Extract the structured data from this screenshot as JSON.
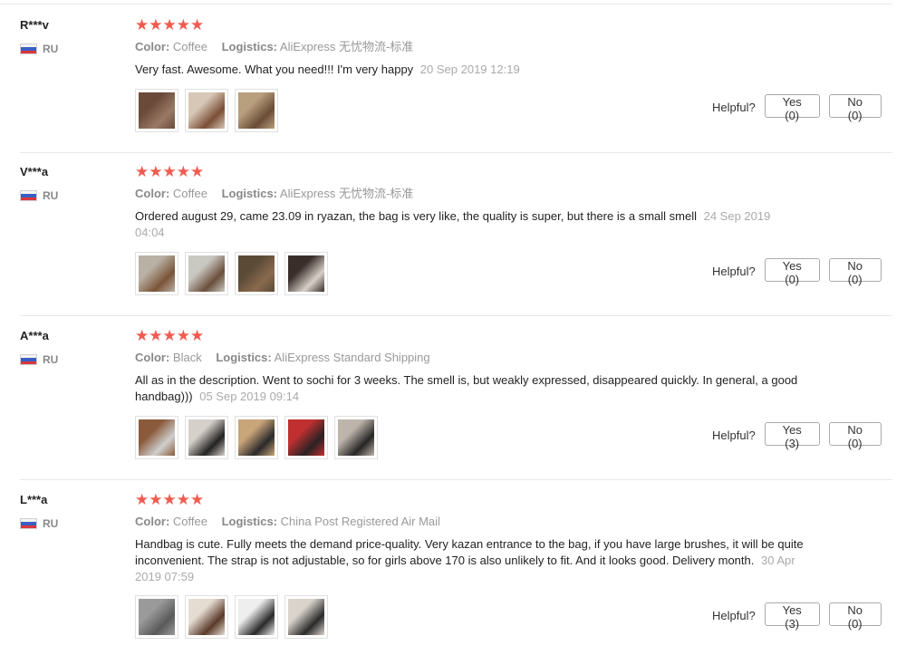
{
  "reviews": [
    {
      "user": "R***v",
      "country": "RU",
      "stars": "★★★★★",
      "color_label": "Color:",
      "color_value": "Coffee",
      "logistics_label": "Logistics:",
      "logistics_value": "AliExpress 无忧物流-标准",
      "text": "Very fast. Awesome. What you need!!! I'm very happy",
      "date": "20 Sep 2019 12:19",
      "photos": [
        {
          "name": "review-photo-1",
          "colors": [
            "#6b4a3a",
            "#9a7a66"
          ]
        },
        {
          "name": "review-photo-2",
          "colors": [
            "#d7c7b6",
            "#7a4e36"
          ]
        },
        {
          "name": "review-photo-3",
          "colors": [
            "#b89f7d",
            "#6a4c36"
          ]
        }
      ],
      "helpful_label": "Helpful?",
      "yes_label": "Yes (0)",
      "no_label": "No (0)"
    },
    {
      "user": "V***a",
      "country": "RU",
      "stars": "★★★★★",
      "color_label": "Color:",
      "color_value": "Coffee",
      "logistics_label": "Logistics:",
      "logistics_value": "AliExpress 无忧物流-标准",
      "text": "Ordered august 29, came 23.09 in ryazan, the bag is very like, the quality is super, but there is a small smell",
      "date": "24 Sep 2019 04:04",
      "photos": [
        {
          "name": "review-photo-1",
          "colors": [
            "#b9b1a4",
            "#7a5438"
          ]
        },
        {
          "name": "review-photo-2",
          "colors": [
            "#c9c9c2",
            "#6b4e3b"
          ]
        },
        {
          "name": "review-photo-3",
          "colors": [
            "#5a4a36",
            "#8a6a4e"
          ]
        },
        {
          "name": "review-photo-4",
          "colors": [
            "#3a2e2a",
            "#d8d0c8"
          ]
        }
      ],
      "helpful_label": "Helpful?",
      "yes_label": "Yes (0)",
      "no_label": "No (0)"
    },
    {
      "user": "A***a",
      "country": "RU",
      "stars": "★★★★★",
      "color_label": "Color:",
      "color_value": "Black",
      "logistics_label": "Logistics:",
      "logistics_value": "AliExpress Standard Shipping",
      "text": "All as in the description. Went to sochi for 3 weeks. The smell is, but weakly expressed, disappeared quickly. In general, a good handbag)))",
      "date": "05 Sep 2019 09:14",
      "photos": [
        {
          "name": "review-photo-1",
          "colors": [
            "#8a5a3a",
            "#cfcfcf"
          ]
        },
        {
          "name": "review-photo-2",
          "colors": [
            "#d6d0ca",
            "#222222"
          ]
        },
        {
          "name": "review-photo-3",
          "colors": [
            "#c9a57a",
            "#2a2a2a"
          ]
        },
        {
          "name": "review-photo-4",
          "colors": [
            "#c03030",
            "#2a2222"
          ]
        },
        {
          "name": "review-photo-5",
          "colors": [
            "#bdb4ab",
            "#262626"
          ]
        }
      ],
      "helpful_label": "Helpful?",
      "yes_label": "Yes (3)",
      "no_label": "No (0)"
    },
    {
      "user": "L***a",
      "country": "RU",
      "stars": "★★★★★",
      "color_label": "Color:",
      "color_value": "Coffee",
      "logistics_label": "Logistics:",
      "logistics_value": "China Post Registered Air Mail",
      "text": "Handbag is cute. Fully meets the demand price-quality. Very kazan entrance to the bag, if you have large brushes, it will be quite inconvenient. The strap is not adjustable, so for girls above 170 is also unlikely to fit. And it looks good. Delivery month.",
      "date": "30 Apr 2019 07:59",
      "photos": [
        {
          "name": "review-photo-1",
          "colors": [
            "#9a9a9a",
            "#5a5a5a"
          ]
        },
        {
          "name": "review-photo-2",
          "colors": [
            "#e6ddd2",
            "#5a3a2a"
          ]
        },
        {
          "name": "review-photo-3",
          "colors": [
            "#eeeeee",
            "#2a2a2a"
          ]
        },
        {
          "name": "review-photo-4",
          "colors": [
            "#d9d3cc",
            "#2b2b2b"
          ]
        }
      ],
      "helpful_label": "Helpful?",
      "yes_label": "Yes (3)",
      "no_label": "No (0)"
    }
  ],
  "colors": {
    "star": "#f05b4f",
    "divider": "#e8e8e8"
  }
}
